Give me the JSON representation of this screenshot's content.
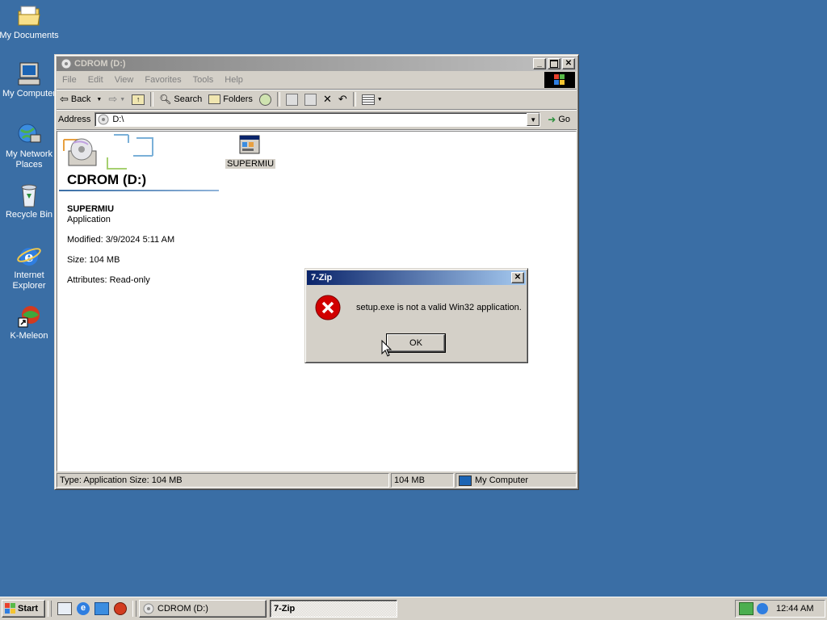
{
  "desktop": {
    "icons": [
      {
        "label": "My Documents",
        "icon": "folder-icon"
      },
      {
        "label": "My Computer",
        "icon": "computer-icon"
      },
      {
        "label": "My Network Places",
        "icon": "network-icon"
      },
      {
        "label": "Recycle Bin",
        "icon": "recycle-bin-icon"
      },
      {
        "label": "Internet Explorer",
        "icon": "internet-explorer-icon"
      },
      {
        "label": "K-Meleon",
        "icon": "k-meleon-icon"
      }
    ]
  },
  "explorer": {
    "title": "CDROM (D:)",
    "menu": [
      "File",
      "Edit",
      "View",
      "Favorites",
      "Tools",
      "Help"
    ],
    "toolbar": {
      "back": "Back",
      "search": "Search",
      "folders": "Folders"
    },
    "address": {
      "label": "Address",
      "value": "D:\\",
      "go": "Go"
    },
    "panel": {
      "heading": "CDROM (D:)",
      "item_name": "SUPERMIU",
      "item_type": "Application",
      "modified": "Modified: 3/9/2024 5:11 AM",
      "size": "Size: 104 MB",
      "attributes": "Attributes: Read-only"
    },
    "files": [
      {
        "name": "SUPERMIU",
        "icon": "application-icon"
      }
    ],
    "status": {
      "info": "Type: Application Size: 104 MB",
      "size": "104 MB",
      "zone": "My Computer"
    }
  },
  "dialog": {
    "title": "7-Zip",
    "message": "setup.exe is not a valid Win32 application.",
    "ok": "OK"
  },
  "taskbar": {
    "start": "Start",
    "tasks": [
      "CDROM (D:)",
      "7-Zip"
    ],
    "clock": "12:44 AM"
  },
  "colors": {
    "desktop": "#3a6ea5",
    "active_title": "#0a246a",
    "error": "#d10000"
  }
}
